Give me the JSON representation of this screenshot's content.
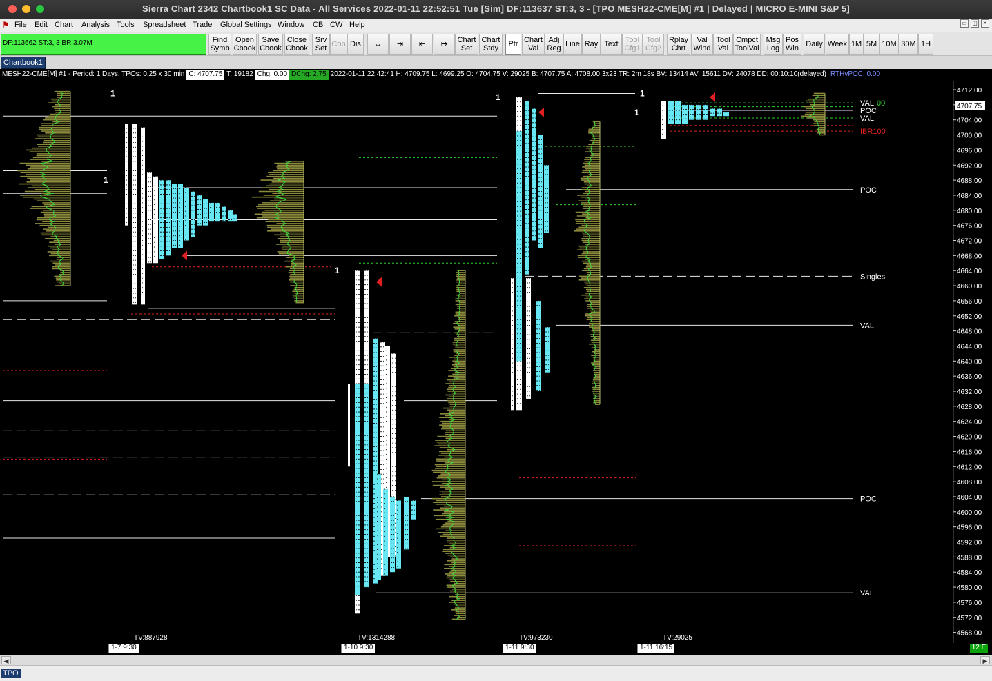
{
  "window": {
    "title": "Sierra Chart 2342 Chartbook1  SC Data - All Services 2022-01-11  22:52:51 Tue [Sim]  DF:113637  ST:3, 3 - [TPO MESH22-CME[M]  #1 | Delayed | MICRO E-MINI S&P 5]"
  },
  "menu": [
    "File",
    "Edit",
    "Chart",
    "Analysis",
    "Tools",
    "Spreadsheet",
    "Trade",
    "Global Settings",
    "Window",
    "CB",
    "CW",
    "Help"
  ],
  "status": {
    "text": "DF:113662  ST:3, 3  BR:3.07M"
  },
  "toolbar": {
    "find_symb": "Find\nSymb",
    "open_cbook": "Open\nCbook",
    "save_cbook": "Save\nCbook",
    "close_cbook": "Close\nCbook",
    "srv_set": "Srv\nSet",
    "con": "Con",
    "dis": "Dis",
    "chart_set": "Chart\nSet",
    "chart_stdy": "Chart\nStdy",
    "ptr": "Ptr",
    "chart_val": "Chart\nVal",
    "adj_reg": "Adj\nReg",
    "line": "Line",
    "ray": "Ray",
    "text": "Text",
    "tool_cfg1": "Tool\nCfg1",
    "tool_cfg2": "Tool\nCfg2",
    "rplay_chrt": "Rplay\nChrt",
    "val_wind": "Val\nWind",
    "tool_val": "Tool\nVal",
    "cmpct_toolval": "Cmpct\nToolVal",
    "msg_log": "Msg\nLog",
    "pos_win": "Pos\nWin",
    "daily": "Daily",
    "week": "Week",
    "m1": "1M",
    "m5": "5M",
    "m10": "10M",
    "m30": "30M",
    "h1": "1H"
  },
  "tabs": {
    "chartbook": "Chartbook1",
    "bottom": "TPO"
  },
  "infoline": {
    "symbol": "MESH22-CME[M]  #1 - Period: 1 Days, TPOs: 0.25 x 30 min",
    "close": "C: 4707.75",
    "trades": "T: 19182",
    "chg": "Chg: 0.00",
    "dchg": "DChg: 2.75",
    "rest": "2022-01-11 22:42:41 H: 4709.75  L: 4699.25  O: 4704.75  V: 29025  B: 4707.75  A: 4708.00  3x23  TR: 2m 18s  BV: 13414  AV: 15611  DV: 24078  DD: 00:10:10(delayed)",
    "rthvpoc": "RTHvPOC: 0.00"
  },
  "colors": {
    "tpo": "#67e6f3",
    "profile": "#8b8a3b",
    "va_line": "#2fd02f",
    "red": "#e02020"
  },
  "chart_data": {
    "type": "table",
    "price_axis": {
      "labels": [
        "4712.00",
        "4708.00",
        "4704.00",
        "4700.00",
        "4696.00",
        "4692.00",
        "4688.00",
        "4684.00",
        "4680.00",
        "4676.00",
        "4672.00",
        "4668.00",
        "4664.00",
        "4660.00",
        "4656.00",
        "4652.00",
        "4648.00",
        "4644.00",
        "4640.00",
        "4636.00",
        "4632.00",
        "4628.00",
        "4624.00",
        "4620.00",
        "4616.00",
        "4612.00",
        "4608.00",
        "4604.00",
        "4600.00",
        "4596.00",
        "4592.00",
        "4588.00",
        "4584.00",
        "4580.00",
        "4576.00",
        "4572.00",
        "4568.00"
      ],
      "last_price": "4707.75",
      "range": [
        4566,
        4715
      ]
    },
    "sessions": [
      {
        "date_label": "1-7  9:30",
        "volume": "TV:887928",
        "high": 4714,
        "low": 4663
      },
      {
        "date_label": "1-10  9:30",
        "volume": "TV:1314288",
        "high": 4666,
        "low": 4574
      },
      {
        "date_label": "1-11  9:30",
        "volume": "TV:973230",
        "high": 4710,
        "low": 4627
      },
      {
        "date_label": "1-11  16:15",
        "volume": "TV:29025",
        "high": 4711,
        "low": 4699
      }
    ],
    "level_labels": [
      {
        "text": "VAL",
        "price": 4708.5,
        "color": "#ffffff"
      },
      {
        "text": "00",
        "price": 4708.5,
        "color": "#2fd02f"
      },
      {
        "text": "POC",
        "price": 4706.5,
        "color": "#ffffff"
      },
      {
        "text": "VAL",
        "price": 4704.5,
        "color": "#ffffff"
      },
      {
        "text": "IBR100",
        "price": 4701.0,
        "color": "#e02020"
      },
      {
        "text": "POC",
        "price": 4685.5,
        "color": "#ffffff"
      },
      {
        "text": "Singles",
        "price": 4662.5,
        "color": "#ffffff"
      },
      {
        "text": "VAL",
        "price": 4649.5,
        "color": "#ffffff"
      },
      {
        "text": "POC",
        "price": 4603.5,
        "color": "#ffffff"
      },
      {
        "text": "VAL",
        "price": 4578.5,
        "color": "#ffffff"
      }
    ],
    "ones": [
      "1",
      "1",
      "1",
      "1",
      "1",
      "1"
    ]
  },
  "zoom": "12 E"
}
